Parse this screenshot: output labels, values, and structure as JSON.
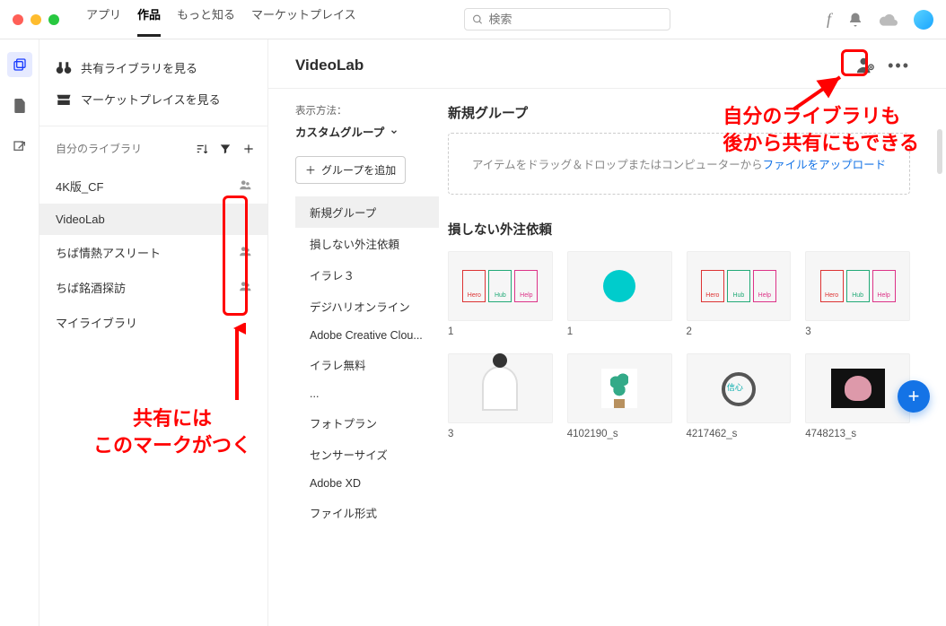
{
  "titlebar": {
    "nav": {
      "apps": "アプリ",
      "works": "作品",
      "learn": "もっと知る",
      "market": "マーケットプレイス"
    },
    "search_placeholder": "検索"
  },
  "rail": {
    "libraries": "ライブラリ",
    "files": "ファイル",
    "share": "共有"
  },
  "sidebar": {
    "link_shared": "共有ライブラリを見る",
    "link_market": "マーケットプレイスを見る",
    "section_label": "自分のライブラリ",
    "sort_icon": "sort-icon",
    "filter_icon": "filter-icon",
    "add_icon": "plus-icon",
    "items": [
      {
        "label": "4K版_CF",
        "shared": true
      },
      {
        "label": "VideoLab",
        "shared": false,
        "selected": true
      },
      {
        "label": "ちば情熱アスリート",
        "shared": true
      },
      {
        "label": "ちば銘酒探訪",
        "shared": true
      },
      {
        "label": "マイライブラリ",
        "shared": false
      }
    ]
  },
  "content": {
    "title": "VideoLab",
    "view_label": "表示方法：",
    "view_value": "カスタムグループ",
    "add_group": "グループを追加",
    "groups": [
      {
        "label": "新規グループ",
        "sel": true
      },
      {
        "label": "損しない外注依頼"
      },
      {
        "label": "イラレ３"
      },
      {
        "label": "デジハリオンライン"
      },
      {
        "label": "Adobe Creative Clou..."
      },
      {
        "label": "イラレ無料"
      },
      {
        "label": "..."
      },
      {
        "label": "フォトプラン"
      },
      {
        "label": "センサーサイズ"
      },
      {
        "label": "Adobe XD"
      },
      {
        "label": "ファイル形式"
      }
    ],
    "section_newgroup": "新規グループ",
    "drop_text_a": "アイテムをドラッグ＆ドロップまたはコンピューターから",
    "drop_text_b": "ファイルをアップロード",
    "section2": "損しない外注依頼",
    "assets_row1": [
      {
        "kind": "boxes",
        "cap": "1"
      },
      {
        "kind": "bluecircle",
        "cap": "1"
      },
      {
        "kind": "boxes",
        "cap": "2"
      },
      {
        "kind": "boxes",
        "cap": "3"
      }
    ],
    "assets_row2": [
      {
        "kind": "person",
        "cap": "3"
      },
      {
        "kind": "plant",
        "cap": "4102190_s"
      },
      {
        "kind": "loupe",
        "cap": "4217462_s"
      },
      {
        "kind": "brain",
        "cap": "4748213_s"
      }
    ]
  },
  "annotations": {
    "right_text_1": "自分のライブラリも",
    "right_text_2": "後から共有にもできる",
    "left_text_1": "共有には",
    "left_text_2": "このマークがつく"
  }
}
